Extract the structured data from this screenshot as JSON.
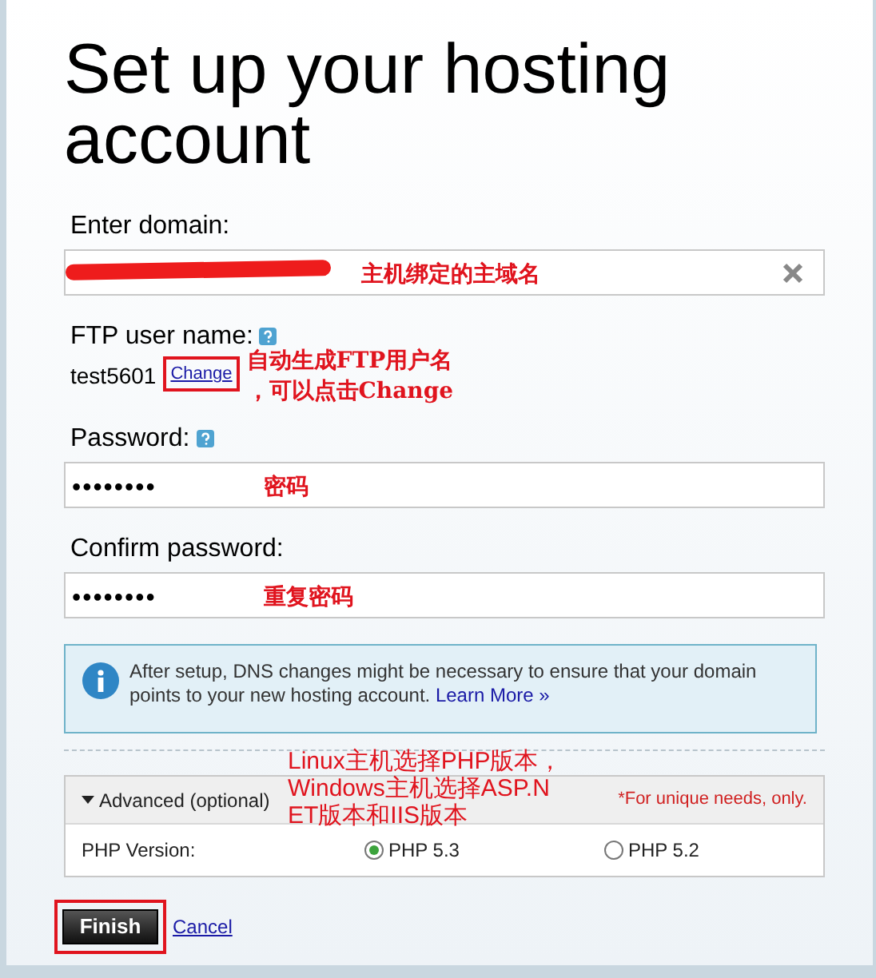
{
  "title": "Set up your hosting account",
  "domain": {
    "label": "Enter domain:",
    "redacted": true,
    "note": "主机绑定的主域名"
  },
  "ftp": {
    "label": "FTP user name:",
    "value": "test5601",
    "change_link": "Change",
    "note_lines": [
      "自动生成FTP用户名",
      "，可以点击Change"
    ]
  },
  "password": {
    "label": "Password:",
    "value": "••••••••",
    "note": "密码"
  },
  "confirm": {
    "label": "Confirm password:",
    "value": "••••••••",
    "note": "重复密码"
  },
  "info": {
    "text": "After setup, DNS changes might be necessary to ensure that your domain points to your new hosting account.",
    "link": "Learn More »"
  },
  "advanced": {
    "label": "Advanced (optional)",
    "expanded": true,
    "hint": "*For unique needs, only.",
    "note_lines": [
      "Linux主机选择PHP版本，",
      "Windows主机选择ASP.N",
      "ET版本和IIS版本"
    ],
    "php_label": "PHP Version:",
    "options": [
      {
        "label": "PHP 5.3",
        "selected": true
      },
      {
        "label": "PHP 5.2",
        "selected": false
      }
    ]
  },
  "finish": "Finish",
  "cancel": "Cancel"
}
